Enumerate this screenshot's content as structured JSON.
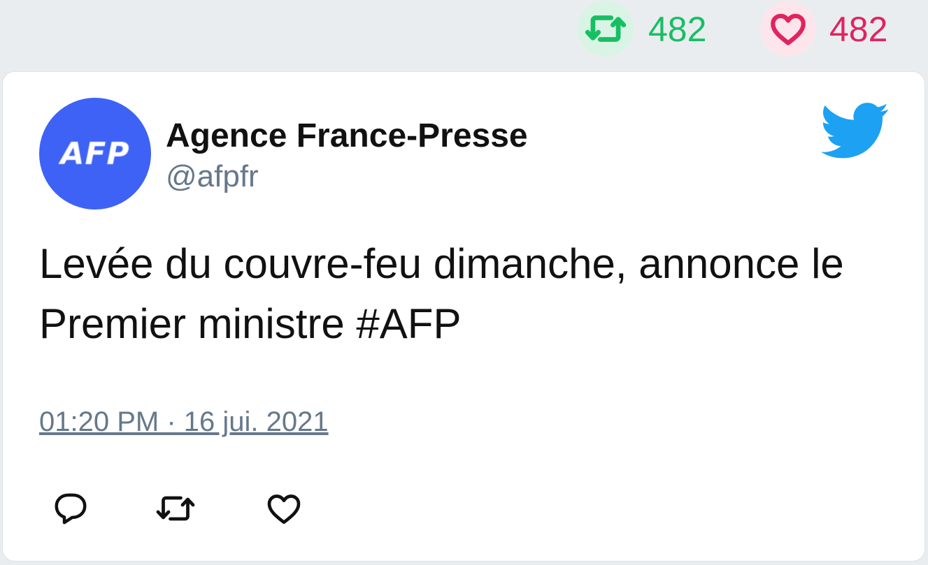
{
  "stats": {
    "retweets": "482",
    "likes": "482",
    "retweet_icon": "retweet-icon",
    "like_icon": "heart-icon",
    "retweet_color": "#17bf63",
    "like_color": "#e0245e"
  },
  "tweet": {
    "author_name": "Agence France-Presse",
    "handle": "@afpfr",
    "avatar_text": "AFP",
    "text": "Levée du couvre-feu dimanche, annonce le Premier ministre #AFP",
    "timestamp": "01:20 PM · 16 jui. 2021",
    "brand_icon": "twitter-bird-icon",
    "brand_color": "#1da1f2",
    "avatar_color": "#3d62f5"
  },
  "actions": {
    "reply_icon": "reply-icon",
    "retweet_icon": "retweet-icon",
    "like_icon": "heart-icon"
  }
}
